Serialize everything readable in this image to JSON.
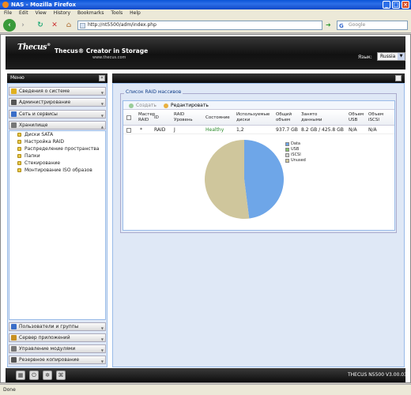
{
  "window": {
    "title": "NAS - Mozilla Firefox"
  },
  "menubar": [
    "File",
    "Edit",
    "View",
    "History",
    "Bookmarks",
    "Tools",
    "Help"
  ],
  "nav": {
    "url": "http://nt5500/adm/index.php",
    "search_placeholder": "Google"
  },
  "header": {
    "logo": "Thecus",
    "tagline": "Thecus® Creator in Storage",
    "site": "www.thecus.com",
    "language_label": "Язык:",
    "language_value": "Russia"
  },
  "sidebar": {
    "title": "Меню",
    "sections": [
      {
        "label": "Сведения о системе",
        "color": "#e0b020"
      },
      {
        "label": "Администрирование",
        "color": "#555"
      },
      {
        "label": "Сеть и сервисы",
        "color": "#3a6ec8"
      },
      {
        "label": "Хранилище",
        "color": "#777"
      }
    ],
    "storage_items": [
      "Диски SATA",
      "Настройка RAID",
      "Распределение пространства",
      "Папки",
      "Стекирование",
      "Монтирование ISO образов"
    ],
    "bottom_sections": [
      {
        "label": "Пользователи и группы",
        "color": "#3a6ec8"
      },
      {
        "label": "Сервер приложений",
        "color": "#c89020"
      },
      {
        "label": "Управление модулями",
        "color": "#777"
      },
      {
        "label": "Резервное копирование",
        "color": "#555"
      }
    ]
  },
  "raid": {
    "legend": "Список RAID массивов",
    "toolbar": {
      "add": "Создать",
      "edit": "Редактировать"
    },
    "columns": {
      "master": [
        "Мастер",
        "RAID"
      ],
      "id": "ID",
      "level": [
        "RAID",
        "Уровень"
      ],
      "status": "Состояние",
      "disks": [
        "Используемые",
        "диски"
      ],
      "total": [
        "Общий",
        "объем"
      ],
      "used": [
        "Занято",
        "данными"
      ],
      "usb": [
        "Объем",
        "USB"
      ],
      "iscsi": [
        "Объем",
        "iSCSI"
      ]
    },
    "row": {
      "master": "*",
      "id": "RAID",
      "level": "J",
      "status": "Healthy",
      "disks": "1,2",
      "total": "937.7 GB",
      "used": "8.2 GB / 425.8 GB",
      "usb": "N/A",
      "iscsi": "N/A"
    }
  },
  "chart_data": {
    "type": "pie",
    "labels": [
      "Data",
      "USB",
      "iSCSI",
      "Unused"
    ],
    "values": [
      48,
      0,
      0,
      52
    ],
    "colors": [
      "#6ea6e8",
      "#86c46a",
      "#cfcfcf",
      "#cfc69c"
    ]
  },
  "footer": {
    "version": "THECUS N5500 V3.00.03"
  },
  "status": {
    "text": "Done"
  }
}
